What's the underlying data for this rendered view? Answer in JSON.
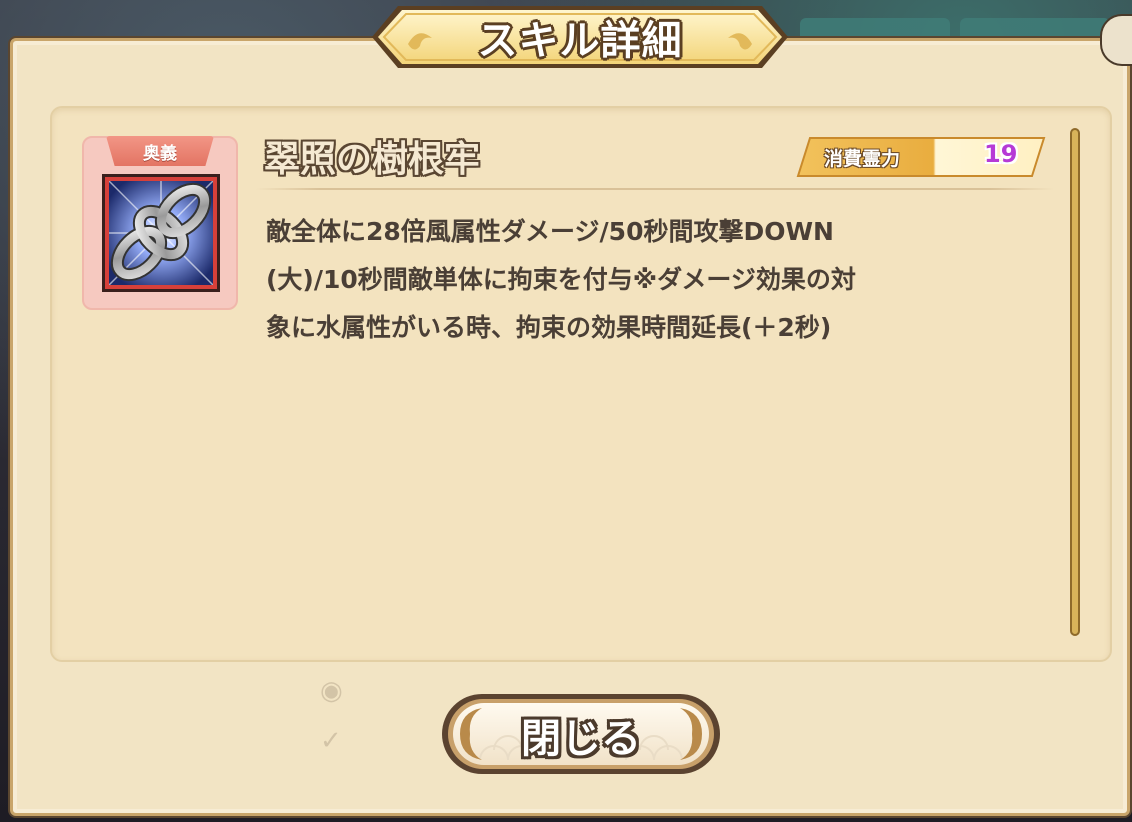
{
  "dialog": {
    "title": "スキル詳細",
    "close_label": "閉じる"
  },
  "skill": {
    "type_badge": "奥義",
    "name": "翠照の樹根牢",
    "cost_label": "消費霊力",
    "cost_value": "19",
    "description": "敵全体に28倍風属性ダメージ/50秒間攻撃DOWN\n(大)/10秒間敵単体に拘束を付与※ダメージ効果の対\n象に水属性がいる時、拘束の効果時間延長(＋2秒)",
    "icon": "chain-icon"
  },
  "colors": {
    "panel_bg": "#f2e4c4",
    "cost_value": "#b63ad6",
    "badge": "#e37463"
  }
}
